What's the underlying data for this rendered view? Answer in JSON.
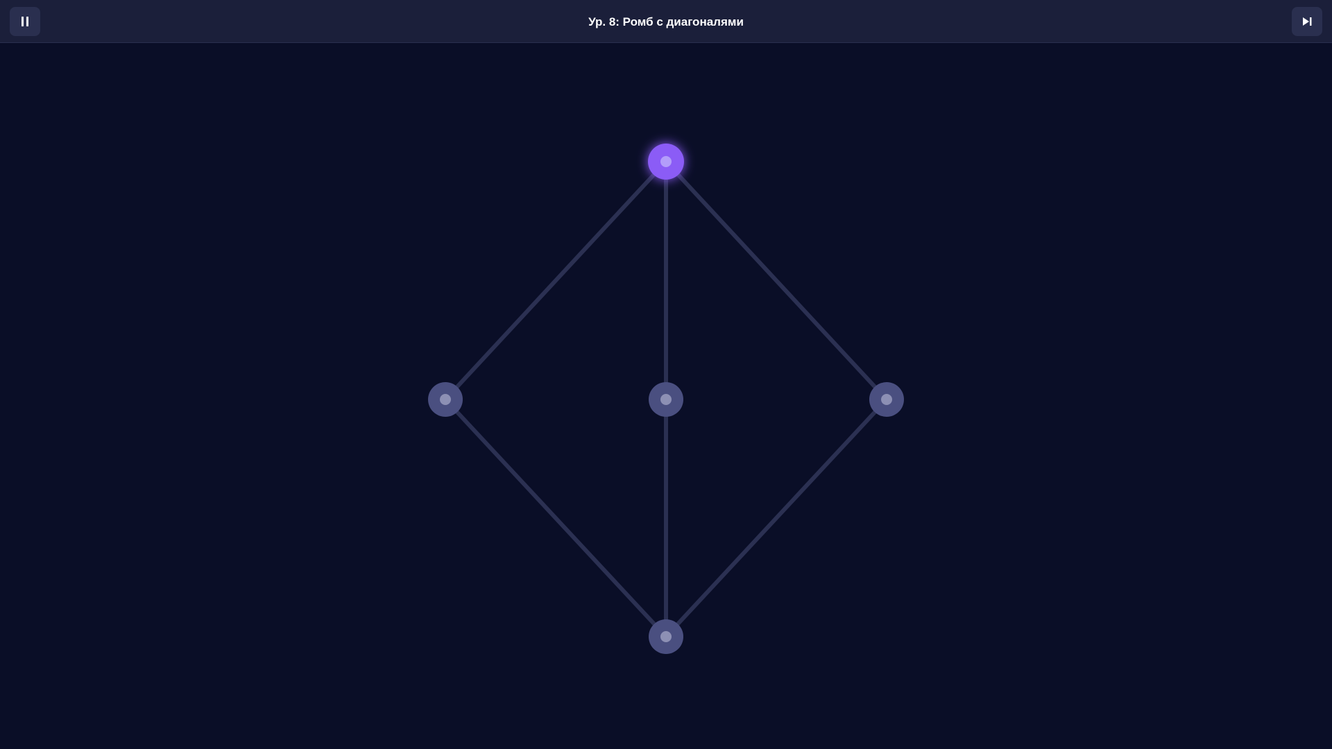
{
  "header": {
    "title": "Ур. 8: Ромб с диагоналями",
    "pause_icon": "pause-icon",
    "skip_icon": "skip-next-icon"
  },
  "colors": {
    "background": "#0a0e27",
    "topbar": "#1b1f3a",
    "edge": "#2b3052",
    "node": "#4a4f80",
    "node_active": "#8b5cf6"
  },
  "puzzle": {
    "nodes": [
      {
        "id": "top",
        "active": true
      },
      {
        "id": "left",
        "active": false
      },
      {
        "id": "center",
        "active": false
      },
      {
        "id": "right",
        "active": false
      },
      {
        "id": "bottom",
        "active": false
      }
    ],
    "edges": [
      [
        "top",
        "left"
      ],
      [
        "top",
        "center"
      ],
      [
        "top",
        "right"
      ],
      [
        "left",
        "bottom"
      ],
      [
        "center",
        "bottom"
      ],
      [
        "right",
        "bottom"
      ]
    ]
  }
}
